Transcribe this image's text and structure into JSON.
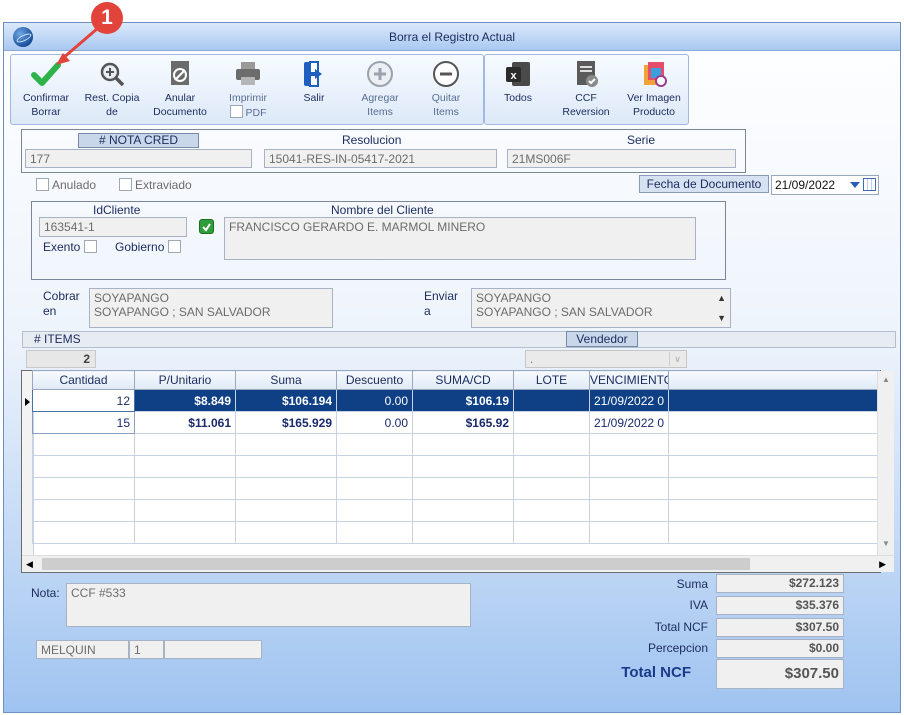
{
  "callout": {
    "number": "1"
  },
  "window": {
    "title": "Borra el Registro Actual"
  },
  "toolbar": {
    "confirm": [
      "Confirmar",
      "Borrar"
    ],
    "restore": [
      "Rest. Copia",
      "de"
    ],
    "void": [
      "Anular",
      "Documento"
    ],
    "print": "Imprimir",
    "pdf": "PDF",
    "exit": "Salir",
    "add": [
      "Agregar",
      "Items"
    ],
    "remove": [
      "Quitar",
      "Items"
    ],
    "all": "Todos",
    "ccf": [
      "CCF",
      "Reversion"
    ],
    "image": [
      "Ver Imagen",
      "Producto"
    ]
  },
  "doc": {
    "nota_label": "# NOTA CRED",
    "nota_value": "177",
    "resolucion_label": "Resolucion",
    "resolucion_value": "15041-RES-IN-05417-2021",
    "serie_label": "Serie",
    "serie_value": "21MS006F",
    "anulado": "Anulado",
    "extraviado": "Extraviado",
    "fecha_label": "Fecha de  Documento",
    "fecha_value": "21/09/2022"
  },
  "client": {
    "id_label": "IdCliente",
    "id_value": "163541-1",
    "name_label": "Nombre del Cliente",
    "name_value": "FRANCISCO GERARDO E. MARMOL MINERO",
    "exento": "Exento",
    "gobierno": "Gobierno"
  },
  "address": {
    "cobrar_label": [
      "Cobrar",
      "en"
    ],
    "cobrar_lines": [
      "SOYAPANGO",
      "SOYAPANGO ; SAN SALVADOR"
    ],
    "enviar_label": [
      "Enviar",
      "a"
    ],
    "enviar_lines": [
      "SOYAPANGO",
      "SOYAPANGO ; SAN SALVADOR"
    ]
  },
  "items_bar": {
    "items_label": "# ITEMS",
    "items_value": "2",
    "vendedor_label": "Vendedor",
    "vendedor_value": "."
  },
  "grid": {
    "headers": [
      "Cantidad",
      "P/Unitario",
      "Suma",
      "Descuento",
      "SUMA/CD",
      "LOTE",
      "VENCIMIENTO"
    ],
    "rows": [
      {
        "qty": "12",
        "price": "$8.849",
        "sum": "$106.194",
        "disc": "0.00",
        "sumcd": "$106.19",
        "lote": "",
        "venc": "21/09/2022 0"
      },
      {
        "qty": "15",
        "price": "$11.061",
        "sum": "$165.929",
        "disc": "0.00",
        "sumcd": "$165.92",
        "lote": "",
        "venc": "21/09/2022 0"
      }
    ]
  },
  "nota": {
    "label": "Nota:",
    "value": "CCF  #533"
  },
  "footer": {
    "user": "MELQUIN",
    "num": "1"
  },
  "totals": {
    "suma_label": "Suma",
    "suma": "$272.123",
    "iva_label": "IVA",
    "iva": "$35.376",
    "total_label": "Total NCF",
    "total": "$307.50",
    "percepcion_label": "Percepcion",
    "percepcion": "$0.00",
    "grand_label": "Total NCF",
    "grand": "$307.50"
  },
  "colors": {
    "accent": "#0f3f85",
    "callout": "#e2443c",
    "check": "#2db34a"
  }
}
